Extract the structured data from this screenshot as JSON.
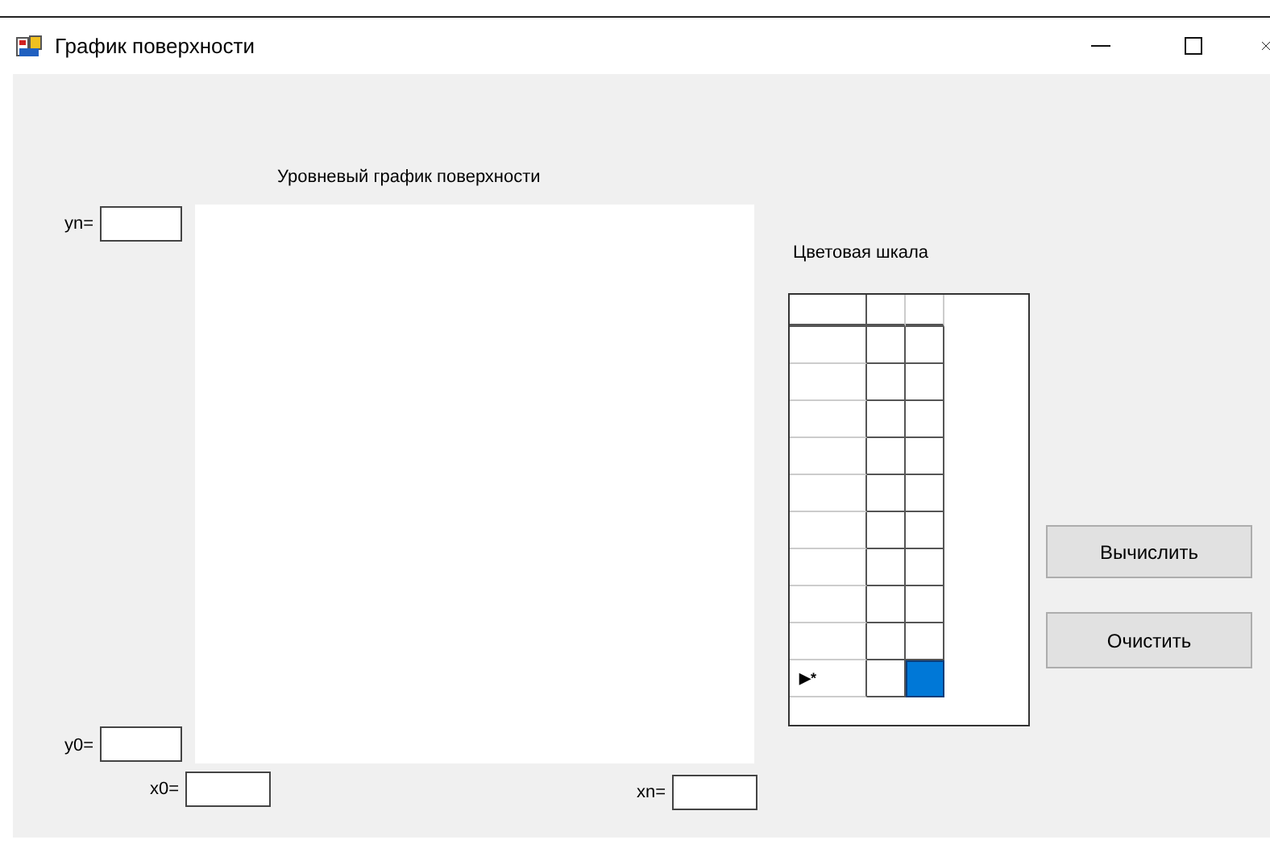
{
  "window": {
    "title": "График поверхности"
  },
  "plot": {
    "title": "Уровневый график поверхности",
    "fields": [
      {
        "label": "yn="
      },
      {
        "label": "y0="
      },
      {
        "label": "x0="
      },
      {
        "label": "xn="
      }
    ]
  },
  "color_scale": {
    "label": "Цветовая шкала",
    "rows": [
      {
        "cells": [
          {
            "selected": false
          },
          {
            "selected": false
          }
        ]
      },
      {
        "cells": [
          {
            "selected": false
          },
          {
            "selected": false
          }
        ]
      },
      {
        "cells": [
          {
            "selected": false
          },
          {
            "selected": false
          }
        ]
      },
      {
        "cells": [
          {
            "selected": false
          },
          {
            "selected": false
          }
        ]
      },
      {
        "cells": [
          {
            "selected": false
          },
          {
            "selected": false
          }
        ]
      },
      {
        "cells": [
          {
            "selected": false
          },
          {
            "selected": false
          }
        ]
      },
      {
        "cells": [
          {
            "selected": false
          },
          {
            "selected": false
          }
        ]
      },
      {
        "cells": [
          {
            "selected": false
          },
          {
            "selected": false
          }
        ]
      },
      {
        "cells": [
          {
            "selected": false
          },
          {
            "selected": false
          }
        ]
      },
      {
        "marker": "▶*",
        "cells": [
          {
            "selected": false
          },
          {
            "selected": true
          }
        ]
      }
    ]
  },
  "buttons": [
    "Вычислить",
    "Очистить"
  ]
}
